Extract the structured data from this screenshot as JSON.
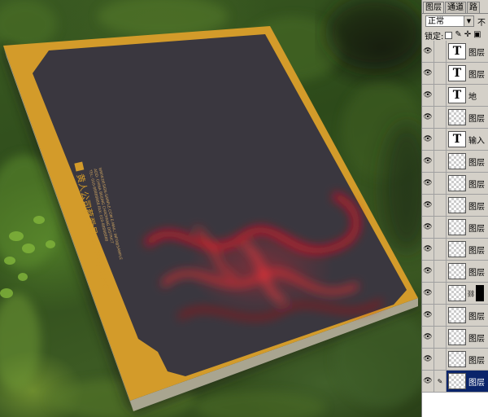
{
  "canvas": {
    "cover_texts": {
      "company_name": "黄人公司蔡爱员",
      "company_name_en": "SONGJOING",
      "small_lines": [
        "TEL: 010-88888888  FAX: 010-88888888",
        "ADD: CHINA BEIJING CHAOYANG DISTRICT",
        "WWW.DESIGN-SAMPLE.COM  E-MAIL: INFO@SAMPLE"
      ]
    },
    "colors": {
      "board_dark": "#3a373f",
      "board_gold": "#d39b2a",
      "smoke_red": "#e01020"
    }
  },
  "panel": {
    "tabs": [
      {
        "label": "图层",
        "active": true
      },
      {
        "label": "通道",
        "active": false
      },
      {
        "label": "路",
        "active": false
      }
    ],
    "blend_mode": "正常",
    "opacity_label": "不",
    "lock_label": "锁定:",
    "layers": [
      {
        "type": "text",
        "glyph": "T",
        "name": "图层"
      },
      {
        "type": "text",
        "glyph": "T",
        "name": "图层"
      },
      {
        "type": "text",
        "glyph": "T",
        "name": "地"
      },
      {
        "type": "raster",
        "name": "图层"
      },
      {
        "type": "text",
        "glyph": "T",
        "name": "输入"
      },
      {
        "type": "raster",
        "name": "图层"
      },
      {
        "type": "raster",
        "name": "图层"
      },
      {
        "type": "raster",
        "name": "图层"
      },
      {
        "type": "raster",
        "name": "图层"
      },
      {
        "type": "raster",
        "name": "图层"
      },
      {
        "type": "raster",
        "name": "图层"
      },
      {
        "type": "mask",
        "name": ""
      },
      {
        "type": "raster",
        "name": "图层"
      },
      {
        "type": "raster",
        "name": "图层"
      },
      {
        "type": "raster",
        "name": "图层"
      },
      {
        "type": "raster",
        "name": "图层",
        "selected": true
      }
    ]
  }
}
